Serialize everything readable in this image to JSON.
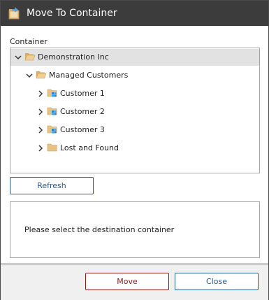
{
  "dialog": {
    "title": "Move To Container",
    "icon": "move-container-icon"
  },
  "container_label": "Container",
  "tree": {
    "nodes": [
      {
        "label": "Demonstration Inc",
        "icon": "folder-open-icon",
        "expanded": true,
        "selected": true
      },
      {
        "label": "Managed Customers",
        "icon": "folder-open-icon",
        "expanded": true,
        "selected": false
      },
      {
        "label": "Customer 1",
        "icon": "customer-folder-icon",
        "expanded": false,
        "selected": false
      },
      {
        "label": "Customer 2",
        "icon": "customer-folder-icon",
        "expanded": false,
        "selected": false
      },
      {
        "label": "Customer 3",
        "icon": "customer-folder-icon",
        "expanded": false,
        "selected": false
      },
      {
        "label": "Lost and Found",
        "icon": "folder-icon",
        "expanded": false,
        "selected": false
      }
    ]
  },
  "buttons": {
    "refresh": "Refresh",
    "move": "Move",
    "close": "Close"
  },
  "message": "Please select the destination container",
  "colors": {
    "titlebar": "#3c3c3c",
    "accent_blue": "#2a5c8a",
    "accent_red": "#8b1a1a",
    "folder": "#e8c184"
  }
}
